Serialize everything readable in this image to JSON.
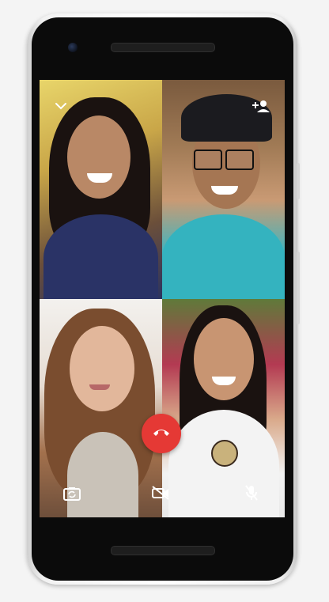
{
  "call": {
    "participants": [
      {
        "position": "top-left"
      },
      {
        "position": "top-right"
      },
      {
        "position": "bottom-left"
      },
      {
        "position": "bottom-right"
      }
    ]
  },
  "icons": {
    "minimize": "chevron-down-icon",
    "add_participant": "add-person-icon",
    "switch_camera": "switch-camera-icon",
    "end_call": "end-call-icon",
    "video_off": "video-off-icon",
    "mute": "mic-off-icon"
  },
  "colors": {
    "end_call": "#e53935",
    "icon": "#ffffff",
    "phone_frame": "#0b0b0b"
  }
}
